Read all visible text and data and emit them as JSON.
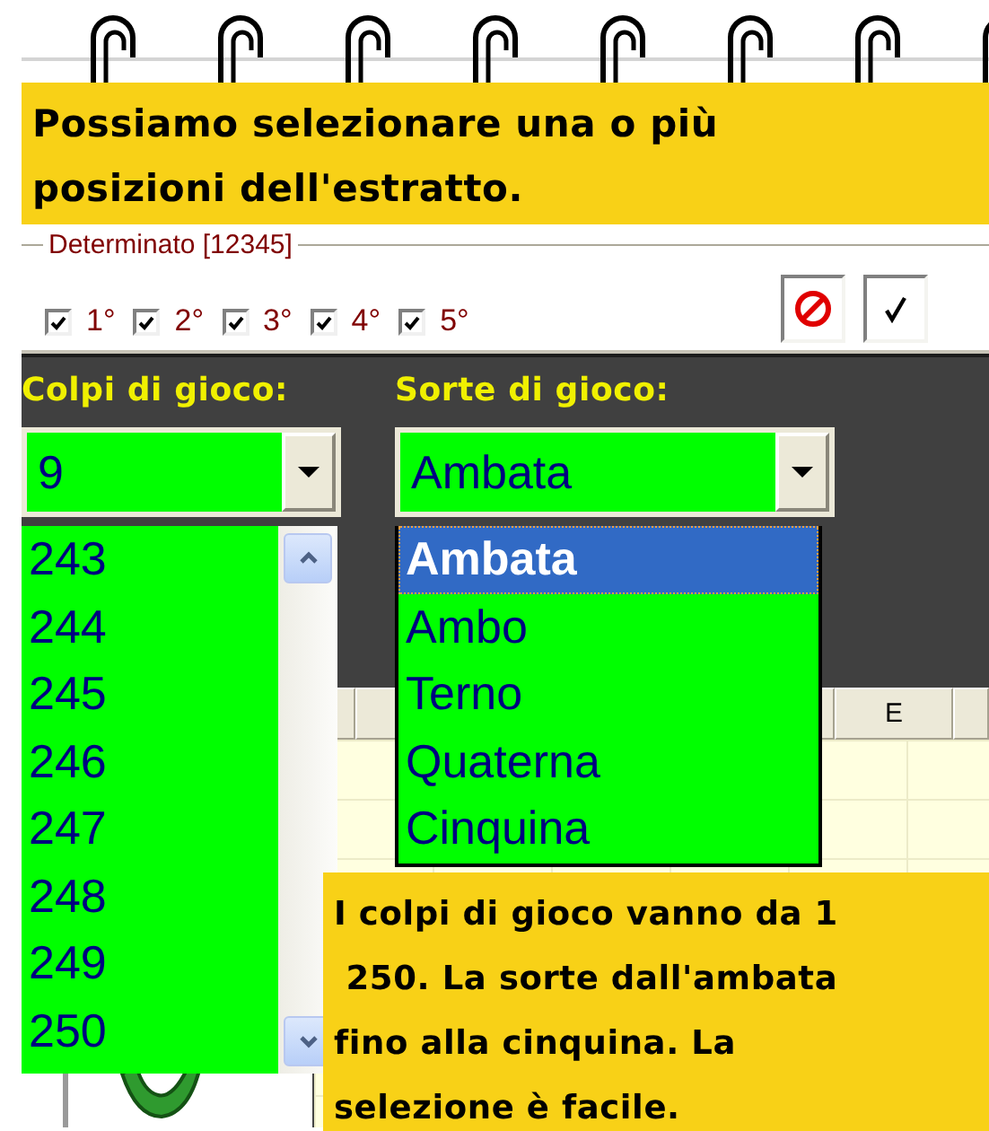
{
  "banner": "Possiamo selezionare una o più posizioni dell'estratto.",
  "positions": {
    "title": "Determinato [12345]",
    "items": [
      {
        "label": "1°",
        "checked": true
      },
      {
        "label": "2°",
        "checked": true
      },
      {
        "label": "3°",
        "checked": true
      },
      {
        "label": "4°",
        "checked": true
      },
      {
        "label": "5°",
        "checked": true
      }
    ]
  },
  "colpi": {
    "label": "Colpi di gioco:",
    "value": "9",
    "options": [
      {
        "text": "243",
        "selected": false
      },
      {
        "text": "244",
        "selected": false
      },
      {
        "text": "245",
        "selected": false
      },
      {
        "text": "246",
        "selected": false
      },
      {
        "text": "247",
        "selected": false
      },
      {
        "text": "248",
        "selected": false
      },
      {
        "text": "249",
        "selected": false
      },
      {
        "text": "250",
        "selected": false
      }
    ]
  },
  "sorte": {
    "label": "Sorte di gioco:",
    "value": "Ambata",
    "options": [
      {
        "text": "Ambata",
        "selected": true
      },
      {
        "text": "Ambo",
        "selected": false
      },
      {
        "text": "Terno",
        "selected": false
      },
      {
        "text": "Quaterna",
        "selected": false
      },
      {
        "text": "Cinquina",
        "selected": false
      }
    ]
  },
  "grid": {
    "column_header": "E"
  },
  "callout": "I colpi di gioco vanno da 1\n 250. La sorte dall'ambata\nfino alla cinquina. La\nselezione è facile."
}
